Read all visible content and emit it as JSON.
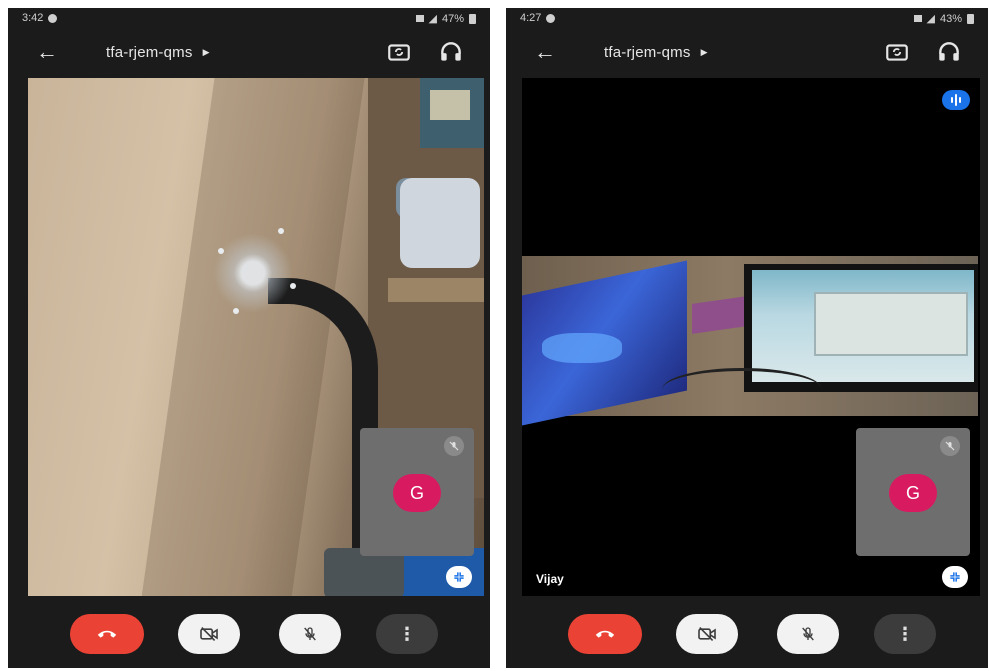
{
  "phones": [
    {
      "status_time": "3:42",
      "status_battery": "47%",
      "meeting_code": "tfa-rjem-qms",
      "self_avatar_letter": "G",
      "participant_name": ""
    },
    {
      "status_time": "4:27",
      "status_battery": "43%",
      "meeting_code": "tfa-rjem-qms",
      "self_avatar_letter": "G",
      "participant_name": "Vijay"
    }
  ],
  "icons": {
    "back": "arrow-left",
    "switch_camera": "switch-camera",
    "audio": "headphones",
    "tile_mute": "mic-off",
    "layout": "grid",
    "speaking": "audio-bars",
    "end_call": "phone-hangup",
    "camera_off": "video-off",
    "mic_off": "mic-off",
    "more": "more-vertical"
  },
  "colors": {
    "end_call": "#ea4335",
    "avatar": "#d81b60",
    "speaking": "#1a73e8",
    "app_background": "#1b1b1b"
  }
}
